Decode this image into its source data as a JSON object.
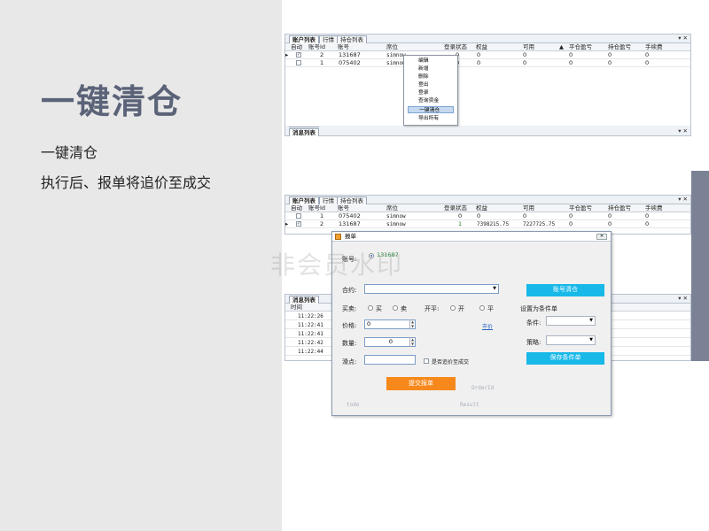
{
  "slide": {
    "title": "一键清仓",
    "line1": "一键清仓",
    "line2": "执行后、报单将追价至成交"
  },
  "top_window": {
    "tabs": [
      "账户列表",
      "行情",
      "持仓列表"
    ],
    "tab_controls": "▾ ✕",
    "columns": [
      "自动",
      "账号Id",
      "账号",
      "席位",
      "登录状态",
      "权益",
      "可用",
      "平仓盈亏",
      "持仓盈亏",
      "手续费"
    ],
    "sort_indicator": "▲",
    "rows": [
      {
        "marker": "▸",
        "checked": true,
        "id": "2",
        "account": "131687",
        "seat": "simnow",
        "status": "0",
        "equity": "0",
        "avail": "0",
        "close_pl": "0",
        "pos_pl": "0",
        "fee": "0"
      },
      {
        "marker": "",
        "checked": false,
        "id": "1",
        "account": "075402",
        "seat": "simnow",
        "status": "0",
        "equity": "0",
        "avail": "0",
        "close_pl": "0",
        "pos_pl": "0",
        "fee": "0"
      }
    ],
    "context_menu": [
      "编辑",
      "新增",
      "删除",
      "登出",
      "登录",
      "查询资金",
      "一键清仓",
      "导出所有"
    ],
    "context_selected_index": 6,
    "msg_tab": "消息列表",
    "msg_controls": "▾ ✕"
  },
  "bottom_window": {
    "tabs": [
      "账户列表",
      "行情",
      "持仓列表"
    ],
    "tab_controls": "▾ ✕",
    "columns": [
      "自动",
      "账号Id",
      "账号",
      "席位",
      "登录状态",
      "权益",
      "可用",
      "平仓盈亏",
      "持仓盈亏",
      "手续费"
    ],
    "rows": [
      {
        "marker": "",
        "checked": false,
        "id": "1",
        "account": "075402",
        "seat": "simnow",
        "status": "0",
        "equity": "0",
        "avail": "0",
        "close_pl": "0",
        "pos_pl": "0",
        "fee": "0"
      },
      {
        "marker": "▸",
        "checked": true,
        "id": "2",
        "account": "131687",
        "seat": "simnow",
        "status": "1",
        "equity": "7398215.75",
        "avail": "7227725.75",
        "close_pl": "0",
        "pos_pl": "0",
        "fee": "0"
      }
    ],
    "msg_tab": "消息列表",
    "msg_controls": "▾ ✕",
    "msg_header": "时间",
    "msg_times": [
      "11:22:26",
      "11:22:41",
      "11:22:41",
      "11:22:42",
      "11:22:44"
    ]
  },
  "dialog": {
    "title": "报单",
    "close": "✕",
    "account_label": "账号:",
    "account_value": "131687",
    "contract_label": "合约:",
    "clear_button": "账号清仓",
    "side_label": "买卖:",
    "buy": "买",
    "sell": "卖",
    "oc_label": "开平:",
    "open": "开",
    "close_pos": "平",
    "price_label": "价格:",
    "price_value": "0",
    "market_price_link": "市价",
    "qty_label": "数量:",
    "qty_value": "0",
    "slip_label": "滑点:",
    "chase_label": "是否追价至成交",
    "cond_title": "设置为条件单",
    "cond_label": "条件:",
    "strategy_label": "策略:",
    "save_cond_button": "保存条件单",
    "submit_button": "提交报单",
    "faint_orderid": "OrderId",
    "faint_todo": "todo",
    "faint_result": "Result"
  },
  "watermark": "非会员水印"
}
